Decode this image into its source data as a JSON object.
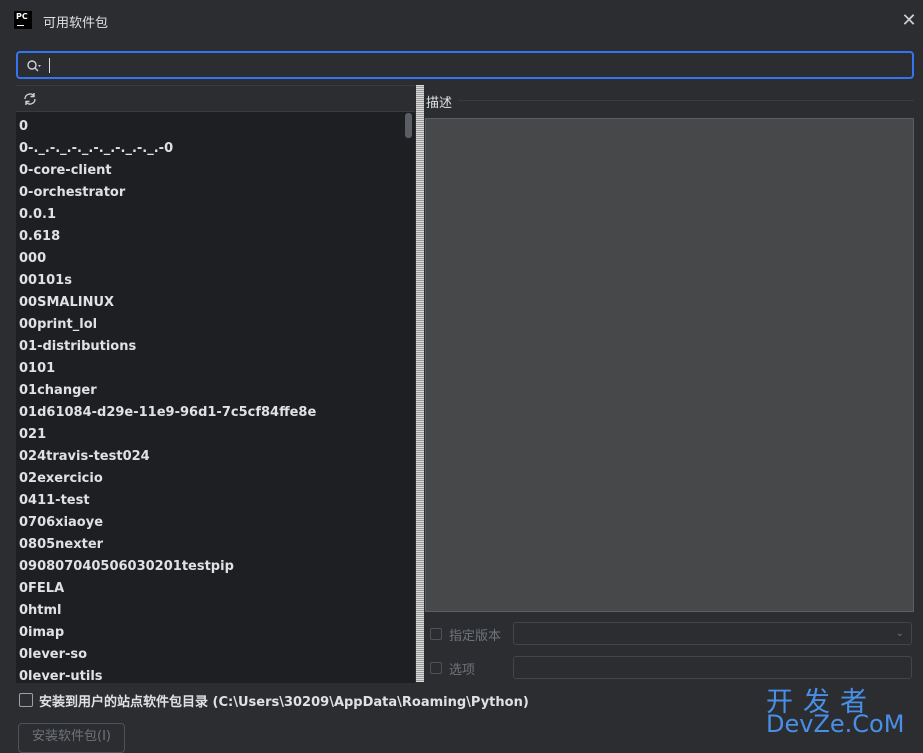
{
  "window": {
    "title": "可用软件包",
    "app_logo_text": "PC"
  },
  "search": {
    "value": "",
    "placeholder": ""
  },
  "packages": [
    "0",
    "0-._.-._.-._.-._.-._.-._.-0",
    "0-core-client",
    "0-orchestrator",
    "0.0.1",
    "0.618",
    "000",
    "00101s",
    "00SMALINUX",
    "00print_lol",
    "01-distributions",
    "0101",
    "01changer",
    "01d61084-d29e-11e9-96d1-7c5cf84ffe8e",
    "021",
    "024travis-test024",
    "02exercicio",
    "0411-test",
    "0706xiaoye",
    "0805nexter",
    "090807040506030201testpip",
    "0FELA",
    "0html",
    "0imap",
    "0lever-so",
    "0lever-utils"
  ],
  "description": {
    "label": "描述",
    "text": ""
  },
  "options": {
    "specify_version_label": "指定版本",
    "specify_version_value": "",
    "options_label": "选项",
    "options_value": ""
  },
  "install_to_user": {
    "label": "安装到用户的站点软件包目录 (C:\\Users\\30209\\AppData\\Roaming\\Python)",
    "checked": false
  },
  "install_button": {
    "label": "安装软件包(I)"
  },
  "watermark": {
    "line1": "开发者",
    "line2": "DevZe.CoM"
  },
  "colors": {
    "accent": "#3574f0",
    "background": "#2b2d30",
    "list_background": "#1e1f22",
    "watermark": "#4a8fe6"
  }
}
